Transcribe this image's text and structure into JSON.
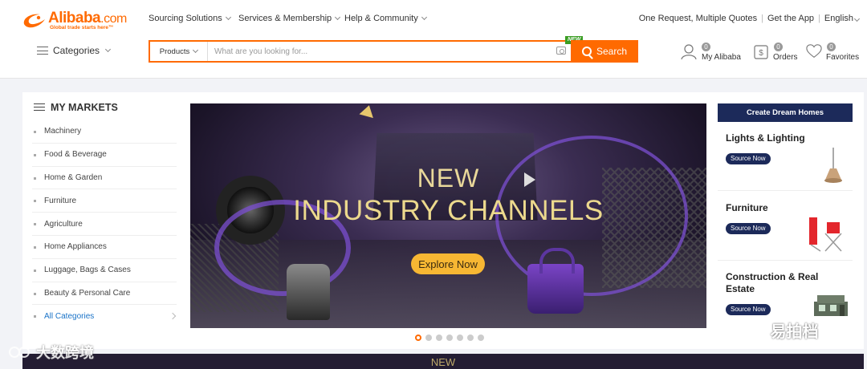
{
  "header": {
    "logo_word": "Alibaba",
    "logo_dotcom": ".com",
    "logo_tagline": "Global trade starts here™",
    "nav": [
      "Sourcing Solutions",
      "Services & Membership",
      "Help & Community"
    ],
    "right_links": [
      "One Request, Multiple Quotes",
      "Get the App",
      "English"
    ],
    "categories_label": "Categories",
    "search": {
      "category": "Products",
      "placeholder": "What are you looking for...",
      "button_label": "Search",
      "new_badge": "NEW"
    },
    "user": {
      "my_alibaba": {
        "label": "My Alibaba",
        "count": "0"
      },
      "orders": {
        "label": "Orders",
        "count": "0"
      },
      "favorites": {
        "label": "Favorites",
        "count": "0"
      }
    }
  },
  "markets": {
    "title": "MY MARKETS",
    "items": [
      "Machinery",
      "Food & Beverage",
      "Home & Garden",
      "Furniture",
      "Agriculture",
      "Home Appliances",
      "Luggage, Bags & Cases",
      "Beauty & Personal Care"
    ],
    "all_label": "All Categories"
  },
  "banner": {
    "line1": "NEW",
    "line2": "INDUSTRY CHANNELS",
    "cta": "Explore Now",
    "slide_count": 7,
    "active_slide": 1
  },
  "promo": {
    "title": "Create Dream Homes",
    "button_label": "Source Now",
    "cards": [
      "Lights & Lighting",
      "Furniture",
      "Construction & Real Estate"
    ]
  },
  "bottom_strip": {
    "text": "NEW"
  },
  "watermarks": {
    "left": "大数跨境",
    "right": "易拍档"
  },
  "colors": {
    "accent": "#ff6a00",
    "navy": "#1c2a5a",
    "link": "#1a73c8",
    "gold": "#ecd98d"
  }
}
